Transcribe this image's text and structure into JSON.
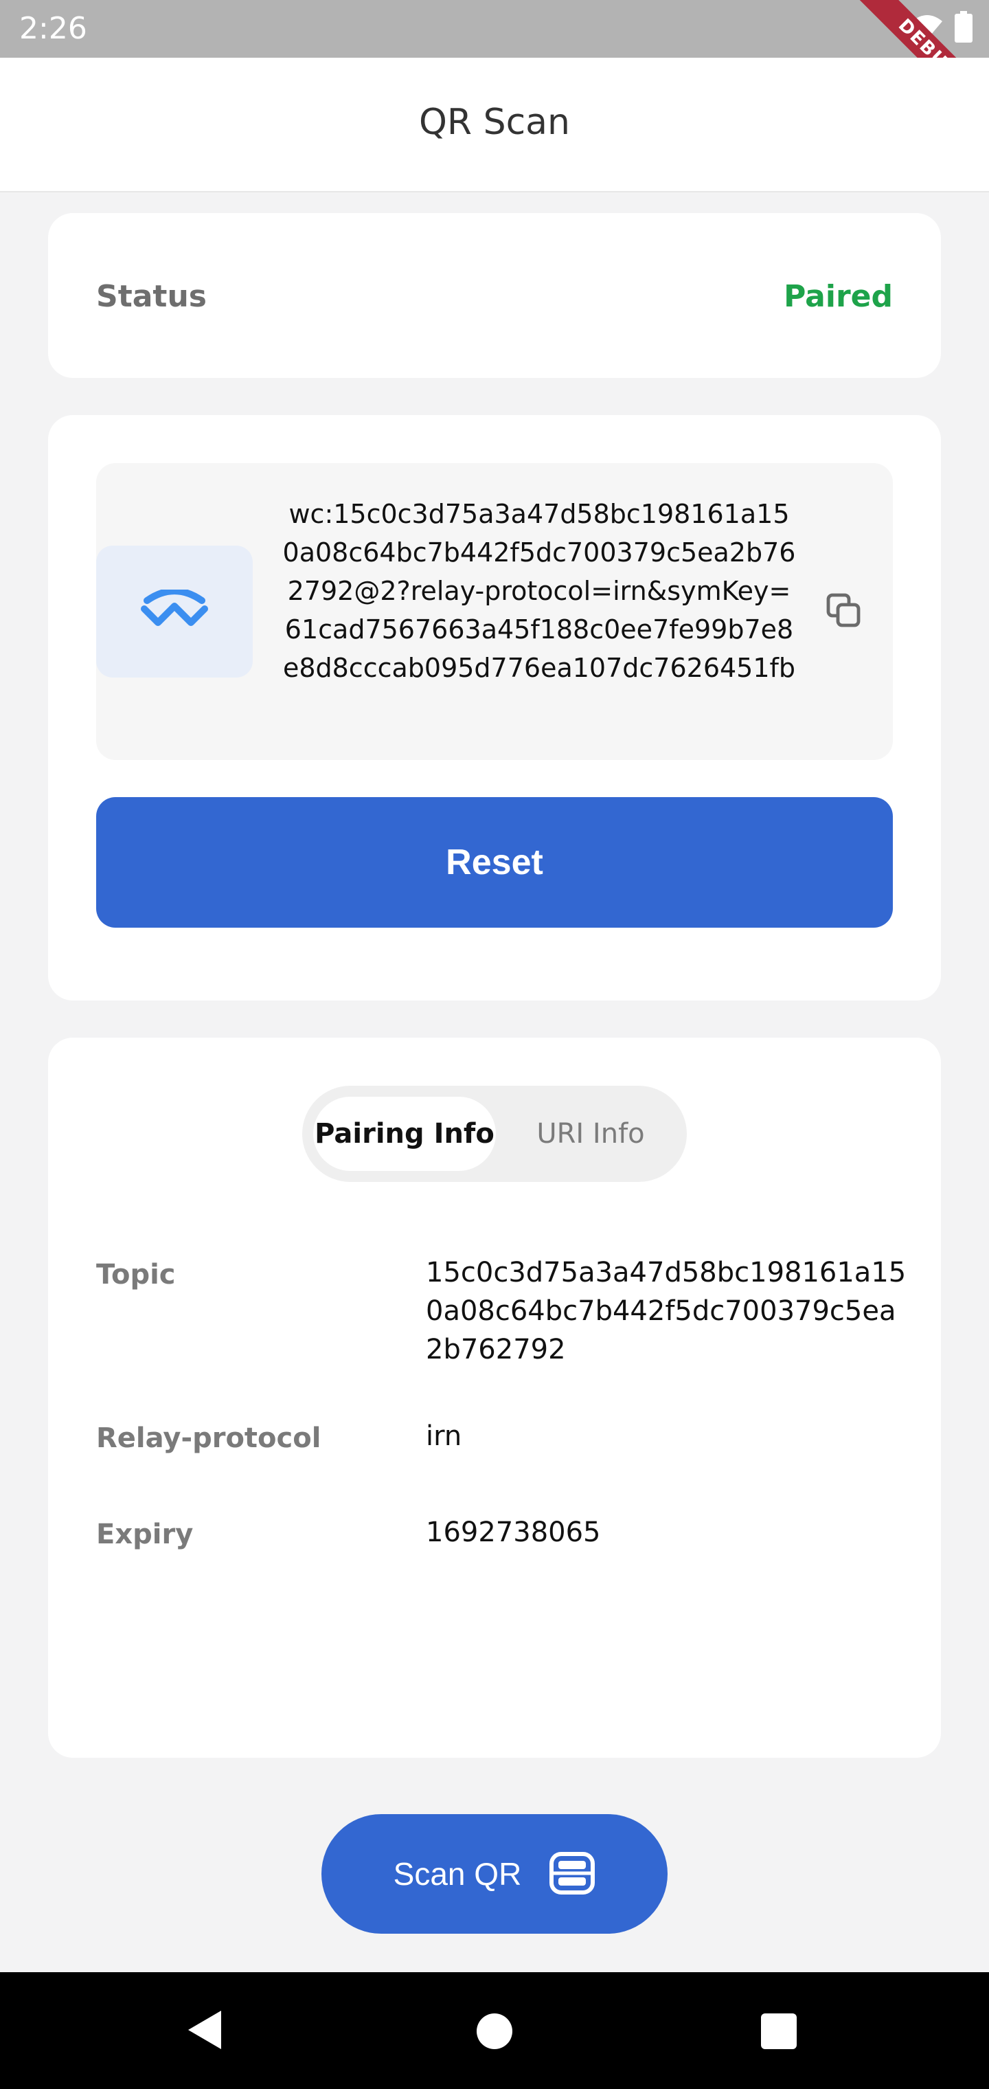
{
  "status_bar": {
    "time": "2:26",
    "debug_label": "DEBUG"
  },
  "app_bar": {
    "title": "QR Scan"
  },
  "status_card": {
    "label": "Status",
    "value": "Paired",
    "value_color": "#1ea34a"
  },
  "uri_card": {
    "uri": "wc:15c0c3d75a3a47d58bc198161a150a08c64bc7b442f5dc700379c5ea2b762792@2?relay-protocol=irn&symKey=61cad7567663a45f188c0ee7fe99b7e8e8d8cccab095d776ea107dc7626451fb",
    "reset_label": "Reset",
    "icons": {
      "logo": "walletconnect-logo-icon",
      "copy": "copy-icon"
    }
  },
  "info_card": {
    "tabs": [
      {
        "label": "Pairing Info",
        "active": true
      },
      {
        "label": "URI Info",
        "active": false
      }
    ],
    "rows": [
      {
        "label": "Topic",
        "value": "15c0c3d75a3a47d58bc198161a150a08c64bc7b442f5dc700379c5ea2b762792"
      },
      {
        "label": "Relay-protocol",
        "value": "irn"
      },
      {
        "label": "Expiry",
        "value": "1692738065"
      }
    ]
  },
  "scan_button": {
    "label": "Scan QR",
    "icon": "qr-scan-icon"
  },
  "colors": {
    "accent": "#3367d1",
    "success": "#1ea34a",
    "background": "#f3f3f4"
  }
}
